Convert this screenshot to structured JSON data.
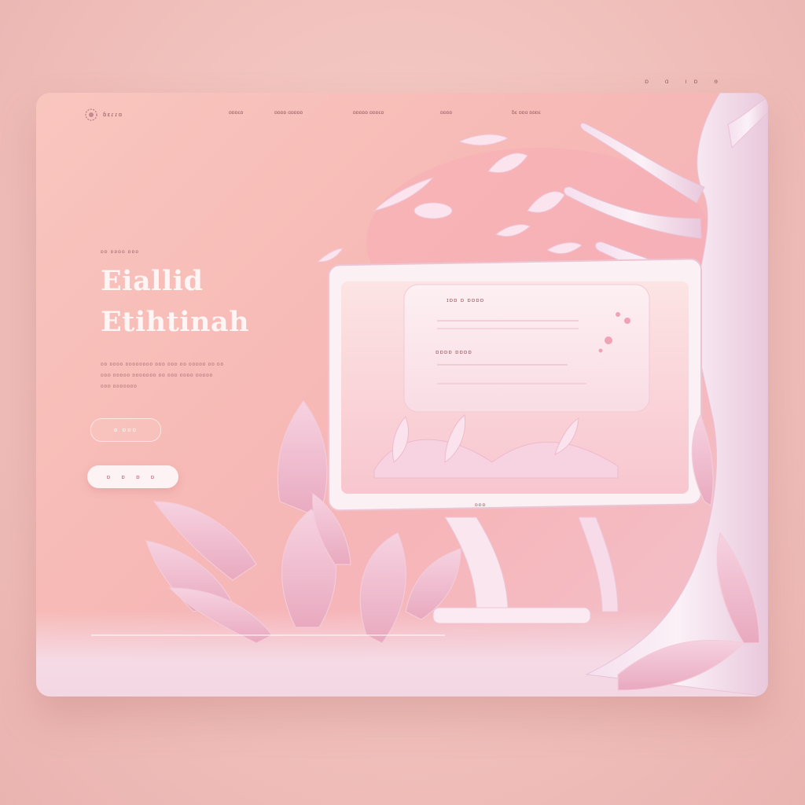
{
  "corner_glyphs": "ɒ ɑ ıɒ ɘ",
  "nav": {
    "logo_text": "ɓɛɾɾɑ",
    "links": [
      "ɒɒɒɛɒ",
      "ɒɒɒɒ ɑɒɒɒɒ",
      "ɒɒɒɒɒ ɒɒɒɛɒ",
      "ɒɒɒɒ",
      "ɓɛ ɒɒɑ ɒɒɒɛ"
    ]
  },
  "hero": {
    "eyebrow": "ɒɒ ɒɒɒɒ ɒɒɒ",
    "headline_line1": "Eiallid",
    "headline_line2": "Etihtinah",
    "body_line1": "ɒɒ ɒɒɒɒ ɒɒɒɒɒɒɒɒ ɒɒɒ ɒɒɒ ɒɒ ɒɒɒɒɒ ɒɒ ɒɒ",
    "body_line2": "ɒɒɒ ɒɒɒɒɒ ɒɒɒɒɒɒɒ ɒɒ ɒɒɒ ɒɒɒɒ ɒɒɒɒɒ",
    "body_line3": "ɒɒɒ ɒɒɒɒɒɒɒ",
    "outline_button": "ɒ ɒɒɒ",
    "solid_button": "ɒ ɒ ɒ ɒ"
  },
  "monitor": {
    "title": "ɪɒɒ ɒ ɒɒɒɒ",
    "field_label": "ɒɒɒɒ ɒɒɒɒ",
    "brand": "ɒɒɒ"
  },
  "colors": {
    "background": "#f2c4c0",
    "page": "#f7bab6",
    "accent": "#c2576a",
    "white": "#fdf3f4"
  },
  "icons": [
    "logo-mark-icon",
    "tree-illustration",
    "leaf-illustration",
    "monitor-illustration"
  ]
}
